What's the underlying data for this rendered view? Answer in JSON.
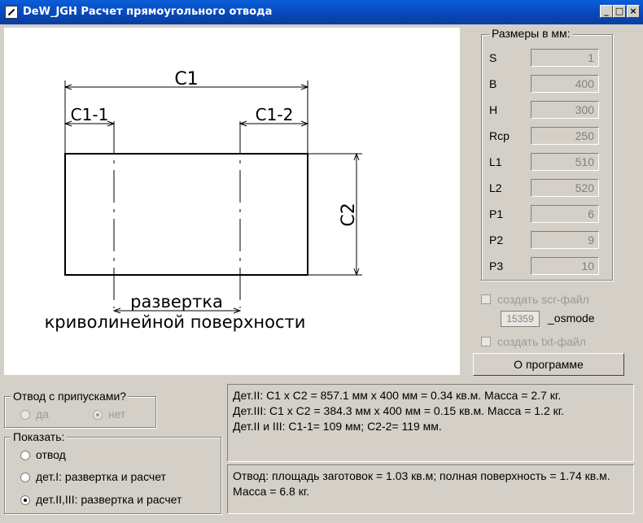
{
  "window": {
    "title": "DeW_JGH Расчет прямоугольного отвода",
    "minimize": "_",
    "maximize": "□",
    "close": "×"
  },
  "drawing": {
    "c1": "C1",
    "c1_1": "C1-1",
    "c1_2": "C1-2",
    "c2": "C2",
    "caption_line1": "развертка",
    "caption_line2": "криволинейной поверхности"
  },
  "dimensions": {
    "title": "Размеры в мм:",
    "fields": [
      {
        "label": "S",
        "value": "1"
      },
      {
        "label": "B",
        "value": "400"
      },
      {
        "label": "H",
        "value": "300"
      },
      {
        "label": "Rср",
        "value": "250"
      },
      {
        "label": "L1",
        "value": "510"
      },
      {
        "label": "L2",
        "value": "520"
      },
      {
        "label": "P1",
        "value": "6"
      },
      {
        "label": "P2",
        "value": "9"
      },
      {
        "label": "P3",
        "value": "10"
      }
    ]
  },
  "options": {
    "scr_label": "создать scr-файл",
    "osmode_value": "15359",
    "osmode_label": "_osmode",
    "txt_label": "создать txt-файл"
  },
  "about_button": "О программе",
  "allowance": {
    "title": "Отвод с припусками?",
    "yes": "да",
    "no": "нет",
    "selected": "нет"
  },
  "show": {
    "title": "Показать:",
    "items": [
      "отвод",
      "дет.I: развертка и расчет",
      "дет.II,III: развертка и расчет"
    ],
    "selected": "дет.II,III: развертка и расчет"
  },
  "results": {
    "line1": "Дет.II: С1 x С2 = 857.1 мм x 400 мм = 0.34 кв.м. Масса = 2.7 кг.",
    "line2": "Дет.III: С1 x С2 = 384.3 мм x 400 мм = 0.15 кв.м. Масса = 1.2 кг.",
    "line3": "Дет.II и III: С1-1= 109 мм; С2-2= 119 мм."
  },
  "summary": "Отвод: площадь заготовок = 1.03 кв.м; полная поверхность = 1.74 кв.м. Масса = 6.8 кг."
}
